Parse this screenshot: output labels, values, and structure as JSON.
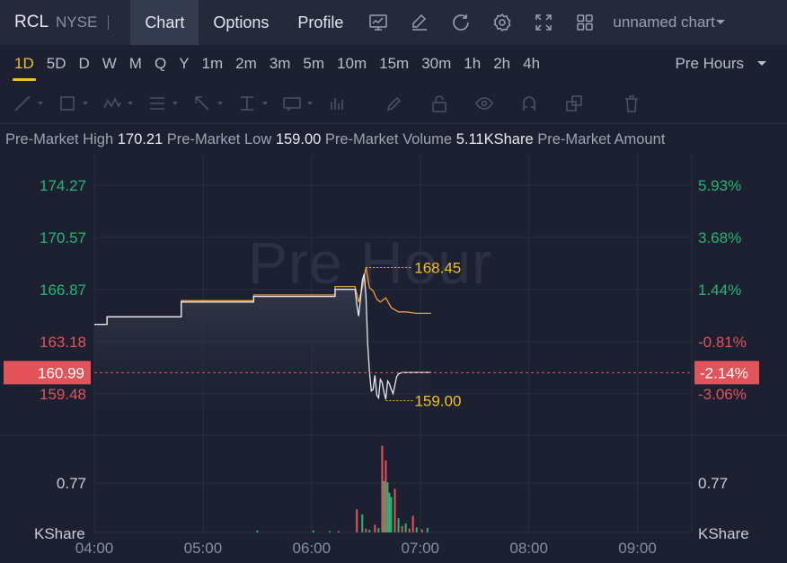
{
  "header": {
    "symbol": "RCL",
    "exchange": "NYSE",
    "tabs": [
      {
        "label": "Chart",
        "active": true
      },
      {
        "label": "Options",
        "active": false
      },
      {
        "label": "Profile",
        "active": false
      }
    ],
    "toolbar_icons": [
      "indicators-icon",
      "draw-icon",
      "refresh-icon",
      "settings-icon",
      "fullscreen-icon",
      "layout-grid-icon"
    ],
    "chart_name": "unnamed chart"
  },
  "intervals": {
    "items": [
      "1D",
      "5D",
      "D",
      "W",
      "M",
      "Q",
      "Y",
      "1m",
      "2m",
      "3m",
      "5m",
      "10m",
      "15m",
      "30m",
      "1h",
      "2h",
      "4h"
    ],
    "selected": "1D",
    "session_label": "Pre Hours"
  },
  "draw_tools": [
    "trend-line-icon",
    "rectangle-icon",
    "pattern-icon",
    "fib-icon",
    "arrow-icon",
    "measure-icon",
    "text-note-icon",
    "bar-pattern-icon",
    "pencil-icon",
    "lock-icon",
    "eye-icon",
    "magnet-icon",
    "clone-icon",
    "trash-icon"
  ],
  "info_bar": {
    "high_label": "Pre-Market High",
    "high_value": "170.21",
    "low_label": "Pre-Market Low",
    "low_value": "159.00",
    "volume_label": "Pre-Market Volume",
    "volume_value": "5.11KShare",
    "amount_label": "Pre-Market Amount"
  },
  "watermark": "Pre Hour",
  "colors": {
    "background": "#1c2030",
    "up": "#26b573",
    "down": "#e3545a",
    "price_line": "#f29a3b",
    "avg_line": "#e7e9ef",
    "annotation": "#f0c020"
  },
  "chart_data": {
    "type": "line",
    "x_ticks": [
      "04:00",
      "05:00",
      "06:00",
      "07:00",
      "08:00",
      "09:00"
    ],
    "x_range_minutes": [
      240,
      570
    ],
    "y_ticks_left": [
      "174.27",
      "170.57",
      "166.87",
      "163.18",
      "159.48"
    ],
    "y_ticks_left_values": [
      174.27,
      170.57,
      166.87,
      163.18,
      159.48
    ],
    "y_ticks_right": [
      "5.93%",
      "3.68%",
      "1.44%",
      "-0.81%",
      "-3.06%"
    ],
    "ylim": [
      156.8,
      176.2
    ],
    "prev_close": 164.51,
    "last_price": "160.99",
    "last_price_value": 160.99,
    "last_change": "-2.14%",
    "high_annotation": "168.45",
    "high_annotation_value": 168.45,
    "low_annotation": "159.00",
    "low_annotation_value": 159.0,
    "series": [
      {
        "name": "",
        "x": [
          240,
          247,
          247,
          283,
          288,
          288,
          323,
          328,
          328,
          362,
          367,
          373,
          373,
          384,
          386,
          388,
          390,
          392,
          394,
          396,
          398,
          401,
          404,
          408,
          412,
          418,
          426
        ],
        "values": [
          164.42,
          164.42,
          164.95,
          164.95,
          164.95,
          166.1,
          166.1,
          166.1,
          166.5,
          166.5,
          166.5,
          166.5,
          167.1,
          167.1,
          166.0,
          167.0,
          168.45,
          167.0,
          166.8,
          166.2,
          166.0,
          166.3,
          165.6,
          165.3,
          165.3,
          165.2,
          165.2
        ]
      },
      {
        "name": "",
        "x": [
          240,
          247,
          247,
          283,
          288,
          288,
          323,
          328,
          328,
          362,
          367,
          373,
          373,
          384,
          385,
          386,
          387,
          388,
          389,
          390,
          391,
          392,
          393,
          394,
          395,
          396,
          397,
          398,
          399,
          400,
          401,
          402,
          403,
          404,
          405,
          407,
          408,
          410,
          412,
          416,
          420,
          426
        ],
        "values": [
          164.42,
          164.42,
          164.95,
          164.95,
          164.95,
          166.0,
          166.0,
          166.0,
          166.4,
          166.4,
          166.4,
          166.4,
          166.9,
          166.9,
          165.8,
          165.0,
          166.2,
          167.5,
          168.0,
          166.5,
          163.0,
          161.0,
          159.7,
          159.8,
          160.8,
          159.4,
          159.2,
          160.5,
          160.3,
          159.6,
          159.1,
          160.4,
          160.2,
          159.8,
          159.5,
          160.7,
          160.9,
          161.0,
          160.99,
          161.0,
          161.0,
          161.0
        ]
      }
    ],
    "volume": {
      "y_tick": "0.77",
      "y_tick_value": 0.77,
      "unit": "KShare",
      "max": 1.4,
      "bars": [
        {
          "x": 330,
          "v": 0.03,
          "dir": "up"
        },
        {
          "x": 361,
          "v": 0.03,
          "dir": "up"
        },
        {
          "x": 370,
          "v": 0.02,
          "dir": "up"
        },
        {
          "x": 375,
          "v": 0.02,
          "dir": "down"
        },
        {
          "x": 385,
          "v": 0.36,
          "dir": "down"
        },
        {
          "x": 388,
          "v": 0.28,
          "dir": "up"
        },
        {
          "x": 390,
          "v": 0.06,
          "dir": "down"
        },
        {
          "x": 392,
          "v": 0.04,
          "dir": "up"
        },
        {
          "x": 395,
          "v": 0.12,
          "dir": "down"
        },
        {
          "x": 397,
          "v": 0.07,
          "dir": "up"
        },
        {
          "x": 399,
          "v": 1.35,
          "dir": "down"
        },
        {
          "x": 400,
          "v": 0.8,
          "dir": "up"
        },
        {
          "x": 401,
          "v": 1.12,
          "dir": "down"
        },
        {
          "x": 402,
          "v": 0.78,
          "dir": "up"
        },
        {
          "x": 403,
          "v": 0.62,
          "dir": "up"
        },
        {
          "x": 404,
          "v": 0.55,
          "dir": "up"
        },
        {
          "x": 406,
          "v": 0.68,
          "dir": "down"
        },
        {
          "x": 408,
          "v": 0.22,
          "dir": "up"
        },
        {
          "x": 410,
          "v": 0.1,
          "dir": "down"
        },
        {
          "x": 412,
          "v": 0.14,
          "dir": "up"
        },
        {
          "x": 414,
          "v": 0.06,
          "dir": "down"
        },
        {
          "x": 416,
          "v": 0.26,
          "dir": "down"
        },
        {
          "x": 418,
          "v": 0.08,
          "dir": "up"
        },
        {
          "x": 421,
          "v": 0.05,
          "dir": "down"
        },
        {
          "x": 424,
          "v": 0.07,
          "dir": "up"
        }
      ]
    }
  }
}
